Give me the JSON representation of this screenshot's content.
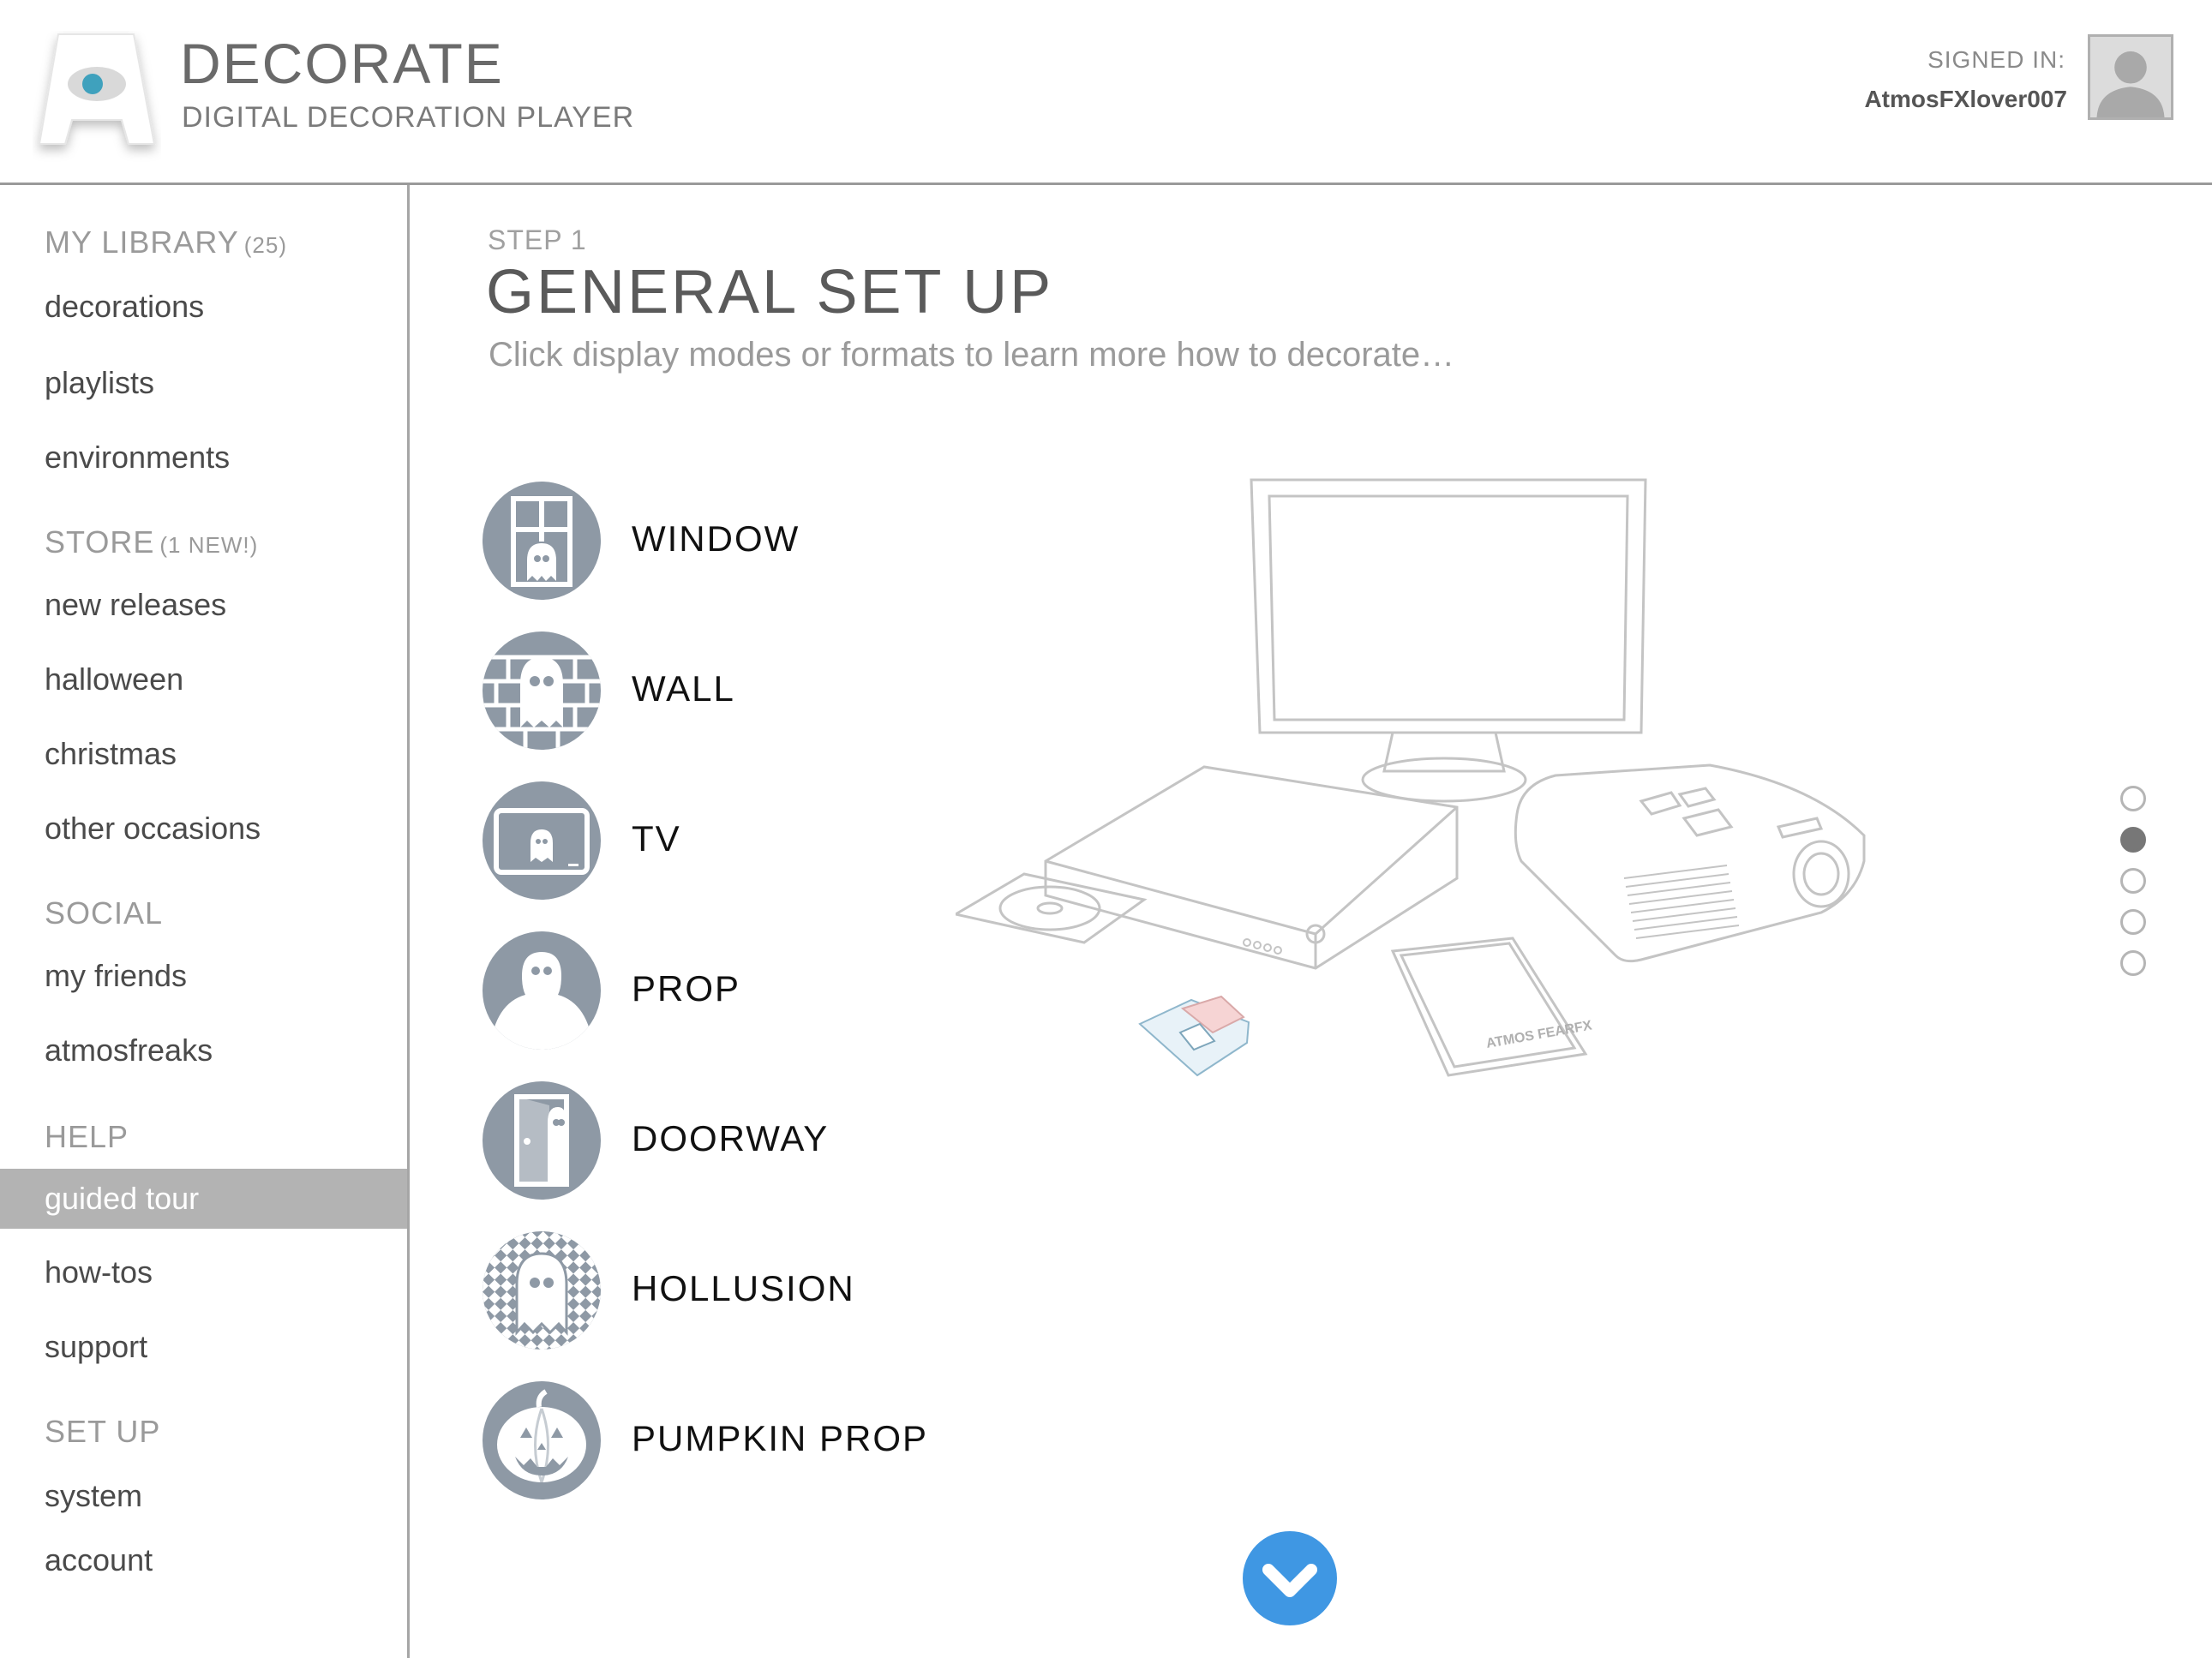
{
  "header": {
    "app_title": "DECORATE",
    "app_subtitle": "DIGITAL DECORATION PLAYER",
    "signed_in_label": "SIGNED IN:",
    "username": "AtmosFXlover007",
    "logo_letter": "A"
  },
  "sidebar": {
    "library": {
      "heading": "MY LIBRARY",
      "count": "(25)",
      "items": [
        "decorations",
        "playlists",
        "environments"
      ]
    },
    "store": {
      "heading": "STORE",
      "count": "(1 NEW!)",
      "items": [
        "new releases",
        "halloween",
        "christmas",
        "other occasions"
      ]
    },
    "social": {
      "heading": "SOCIAL",
      "items": [
        "my friends",
        "atmosfreaks"
      ]
    },
    "help": {
      "heading": "HELP",
      "items": [
        "guided tour",
        "how-tos",
        "support"
      ],
      "active": "guided tour"
    },
    "setup": {
      "heading": "SET UP",
      "items": [
        "system",
        "account"
      ]
    }
  },
  "main": {
    "step": "STEP 1",
    "title": "GENERAL SET UP",
    "instructions": "Click display modes or formats to learn more how to decorate…",
    "modes": [
      {
        "label": "WINDOW",
        "icon": "window-ghost-icon"
      },
      {
        "label": "WALL",
        "icon": "wall-ghost-icon"
      },
      {
        "label": "TV",
        "icon": "tv-ghost-icon"
      },
      {
        "label": "PROP",
        "icon": "prop-ghost-icon"
      },
      {
        "label": "DOORWAY",
        "icon": "doorway-icon"
      },
      {
        "label": "HOLLUSION",
        "icon": "hollusion-ghost-icon"
      },
      {
        "label": "PUMPKIN PROP",
        "icon": "pumpkin-icon"
      }
    ],
    "illustration": {
      "dvd_case_text": "ATMOS FEARFX"
    },
    "pager": {
      "total": 5,
      "active_index": 1
    }
  },
  "colors": {
    "accent": "#3f97e3",
    "icon_bg": "#8e99a5",
    "active_nav": "#b3b3b3",
    "logo_eye": "#3fa1bd"
  }
}
